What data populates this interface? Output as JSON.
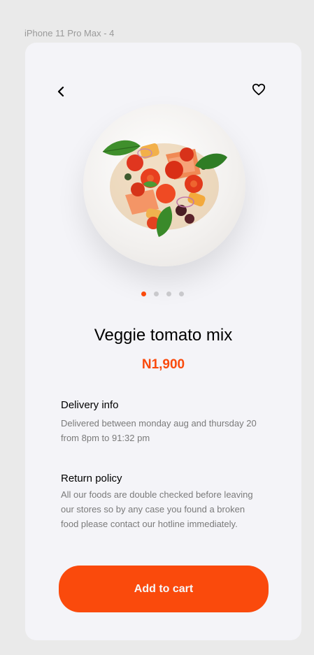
{
  "frame_label": "iPhone 11 Pro Max - 4",
  "header": {
    "back_icon": "chevron-left-icon",
    "favorite_icon": "heart-outline-icon"
  },
  "product": {
    "image": "veggie-tomato-mix-plate",
    "carousel": {
      "count": 4,
      "active_index": 0
    },
    "name": "Veggie tomato mix",
    "price": "N1,900"
  },
  "delivery": {
    "title": "Delivery info",
    "body": "Delivered between monday aug and thursday 20 from 8pm to 91:32 pm"
  },
  "returns": {
    "title": "Return policy",
    "body": "All our foods are double checked before leaving our stores so by any case you found a broken food please contact our hotline immediately."
  },
  "cta": {
    "label": "Add to cart"
  },
  "colors": {
    "accent": "#FA4A0C",
    "screen_bg": "#F4F4F8",
    "page_bg": "#EAEAEA"
  }
}
